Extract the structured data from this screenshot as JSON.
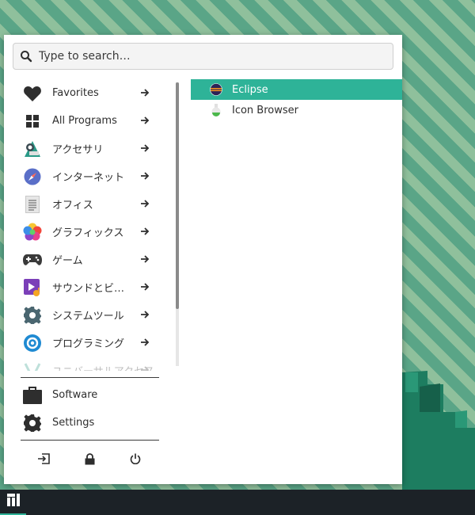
{
  "search": {
    "placeholder": "Type to search…"
  },
  "categories": [
    {
      "label": "Favorites",
      "icon": "heart-icon"
    },
    {
      "label": "All Programs",
      "icon": "grid-icon"
    },
    {
      "label": "アクセサリ",
      "icon": "accessories-icon"
    },
    {
      "label": "インターネット",
      "icon": "compass-icon"
    },
    {
      "label": "オフィス",
      "icon": "document-icon"
    },
    {
      "label": "グラフィックス",
      "icon": "color-petals-icon"
    },
    {
      "label": "ゲーム",
      "icon": "gamepad-icon"
    },
    {
      "label": "サウンドとビ…",
      "icon": "multimedia-icon"
    },
    {
      "label": "システムツール",
      "icon": "system-gear-icon"
    },
    {
      "label": "プログラミング",
      "icon": "programming-gear-icon"
    },
    {
      "label": "ユニバーサルアクセス",
      "icon": "accessibility-icon"
    }
  ],
  "apps": [
    {
      "label": "Eclipse",
      "icon": "eclipse-icon",
      "selected": true
    },
    {
      "label": "Icon Browser",
      "icon": "flask-icon",
      "selected": false
    }
  ],
  "system": {
    "software_label": "Software",
    "settings_label": "Settings"
  },
  "power_buttons": [
    "logout-icon",
    "lock-icon",
    "power-icon"
  ],
  "colors": {
    "accent": "#2eb398",
    "taskbar": "#1c2227",
    "wallpaper_green": "#5aa587"
  }
}
